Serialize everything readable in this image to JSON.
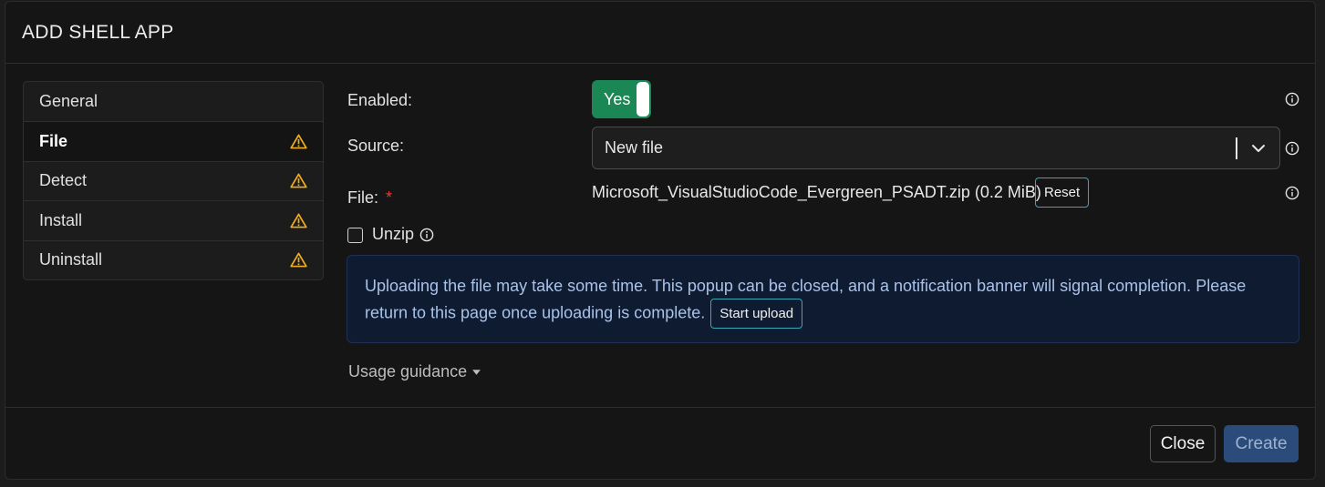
{
  "modal": {
    "title": "ADD SHELL APP"
  },
  "nav": {
    "items": [
      {
        "label": "General",
        "warning": false,
        "active": false
      },
      {
        "label": "File",
        "warning": true,
        "active": true
      },
      {
        "label": "Detect",
        "warning": true,
        "active": false
      },
      {
        "label": "Install",
        "warning": true,
        "active": false
      },
      {
        "label": "Uninstall",
        "warning": true,
        "active": false
      }
    ]
  },
  "form": {
    "enabled_label": "Enabled:",
    "enabled_value": "Yes",
    "source_label": "Source:",
    "source_value": "New file",
    "file_label": "File:",
    "file_required_mark": "*",
    "file_name": "Microsoft_VisualStudioCode_Evergreen_PSADT.zip (0.2 MiB)",
    "reset_label": "Reset",
    "unzip_label": "Unzip"
  },
  "alert": {
    "text": "Uploading the file may take some time. This popup can be closed, and a notification banner will signal completion. Please return to this page once uploading is complete.",
    "button_label": "Start upload"
  },
  "guidance": {
    "label": "Usage guidance"
  },
  "footer": {
    "close_label": "Close",
    "create_label": "Create"
  },
  "colors": {
    "toggle_on": "#1a8754",
    "warning": "#f0ad1e",
    "primary": "#2b4c7a",
    "alert_bg": "#0f1b31",
    "button_outline": "#3aa7b7"
  }
}
